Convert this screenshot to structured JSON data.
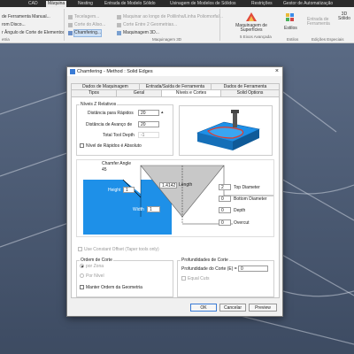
{
  "ribbon": {
    "tabs": [
      "CAD",
      "Máquina",
      "Nesting",
      "Entrada de Modelo Sólido",
      "Usinagem de Modelos de Sólidos",
      "Restrições",
      "Gestor de Automatização"
    ],
    "active_tab": "Máquina",
    "left_items": [
      "de Ferramenta Manual...",
      "rom Disco...",
      "r Ângulo de Corte de Elementos"
    ],
    "middle_items": [
      "Tecelagem...",
      "Corte do Aliso...",
      "Chamfering..."
    ],
    "right_items": [
      "Maquinar ao longo de Polilinha/Linha Poliomorfal...",
      "Corte Entre 2 Geometrias...",
      "Maquinagem 3D..."
    ],
    "surfaces_label": "Maquinagem de Superfícies",
    "eixos_label": "5 Eixos Avançada",
    "estilos_label": "Estilos",
    "entrada_label": "Entrada de Ferramenta",
    "solid_3d_label": "3D Sólido",
    "groups": [
      "etria",
      "Maquinagem 3D",
      "5 Eixos Avançada",
      "Estilos",
      "Edições Especiais"
    ]
  },
  "dialog": {
    "title": "Chamfering - Method : Solid Edges",
    "tabs_row1": [
      "Dados de Maquinagem",
      "Entrada/Saída de Ferramenta",
      "Dados de Ferramenta"
    ],
    "tabs_row2": [
      "Tipos",
      "Geral",
      "Níveis e Cortes",
      "Solid Options"
    ],
    "active_tab": "Níveis e Cortes",
    "z_levels": {
      "group_label": "Níveis Z Relativos",
      "rapid_label": "Distância para Rápidos",
      "rapid_value": "20",
      "feed_label": "Distância de Avanço de",
      "feed_value": "20",
      "total_depth_label": "Total Tool Depth",
      "total_depth_value": "-1",
      "absolute_label": "Nível de Rápidos é Absoluto"
    },
    "diagram": {
      "chamfer_angle_label": "Chamfer Angle",
      "angle_value": "45",
      "height_label": "Height",
      "height_value": "1",
      "length_label": "Length",
      "length_value": "1.4142",
      "width_label": "Width",
      "width_value": "1",
      "top_diameter_label": "Top Diameter",
      "top_diameter_value": "2",
      "bottom_diameter_label": "Bottom Diameter",
      "bottom_diameter_value": "0",
      "depth_label": "Depth",
      "depth_value": "0",
      "overcut_label": "Overcut",
      "overcut_value": "0"
    },
    "constant_offset_label": "Use Constant Offset (Taper tools only)",
    "order": {
      "group_label": "Ordem de Corte",
      "by_zone": "por Zona",
      "by_level": "Por Nível",
      "keep_order": "Manter Ordem da Geometria"
    },
    "depths": {
      "group_label": "Profundidades de Corte",
      "depth_label": "Profundidade do Corte (E) =",
      "depth_value": "0",
      "equal_cuts": "Equal Cuts"
    },
    "buttons": {
      "ok": "OK",
      "cancel": "Cancelar",
      "preview": "Preview"
    }
  },
  "colors": {
    "accent_blue": "#1e90e8",
    "ribbon_bg": "#f1f1f1",
    "viewport": "#4a5a70"
  }
}
